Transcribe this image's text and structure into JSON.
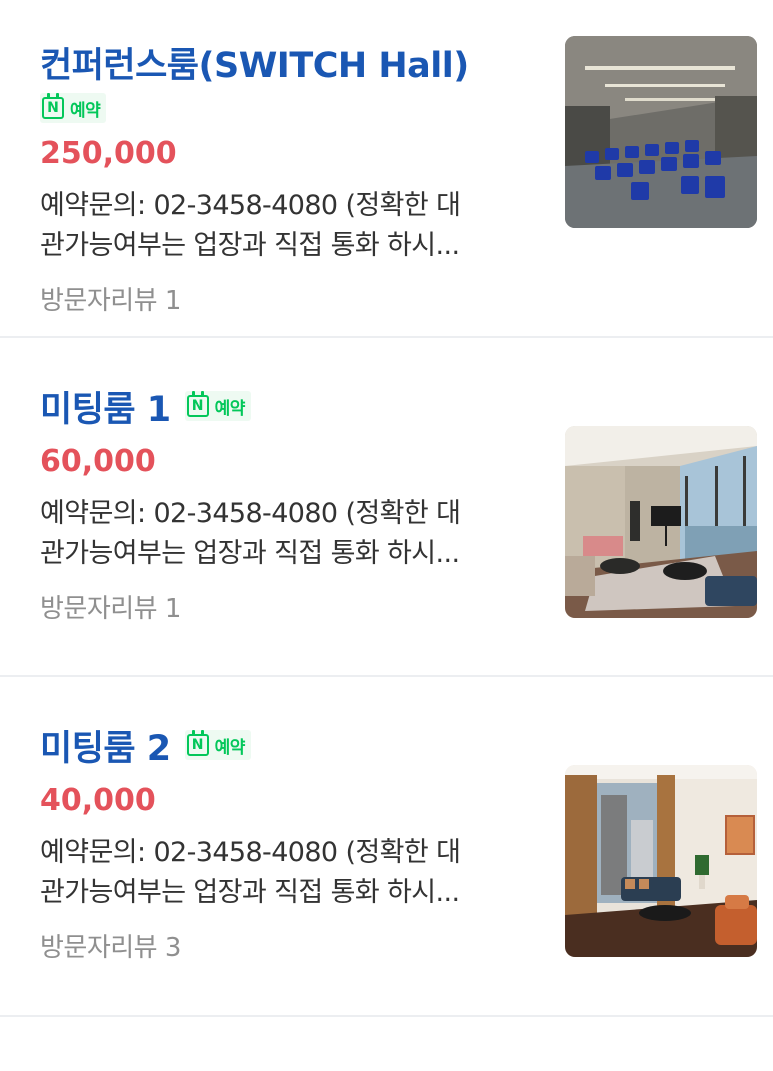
{
  "listings": [
    {
      "title": "컨퍼런스룸(SWITCH Hall)",
      "badge_label": "예약",
      "price": "250,000",
      "description_line1": "예약문의: 02-3458-4080 (정확한 대",
      "description_line2": "관가능여부는 업장과 직접 통화 하시...",
      "reviews": "방문자리뷰 1",
      "thumbnail_icon": "conference-hall-photo"
    },
    {
      "title": "미팅룸 1",
      "badge_label": "예약",
      "price": "60,000",
      "description_line1": "예약문의: 02-3458-4080 (정확한 대",
      "description_line2": "관가능여부는 업장과 직접 통화 하시...",
      "reviews": "방문자리뷰 1",
      "thumbnail_icon": "meeting-room-photo"
    },
    {
      "title": "미팅룸 2",
      "badge_label": "예약",
      "price": "40,000",
      "description_line1": "예약문의: 02-3458-4080 (정확한 대",
      "description_line2": "관가능여부는 업장과 직접 통화 하시...",
      "reviews": "방문자리뷰 3",
      "thumbnail_icon": "meeting-room-photo"
    }
  ],
  "colors": {
    "title": "#1a57b3",
    "price": "#e4525b",
    "badge_green": "#03c75a",
    "text": "#333333",
    "muted": "#8f8f8f"
  }
}
